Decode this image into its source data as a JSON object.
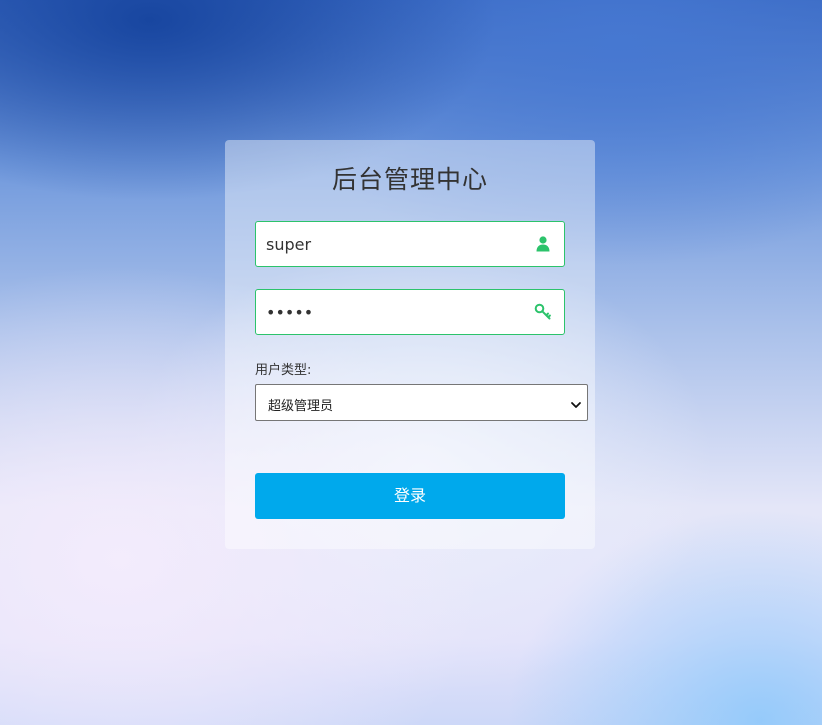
{
  "login": {
    "title": "后台管理中心",
    "username_value": "super",
    "password_value": "•••••",
    "user_type_label": "用户类型:",
    "user_type_selected": "超级管理员",
    "submit_label": "登录"
  },
  "icons": {
    "username": "user-icon",
    "password": "key-icon",
    "select": "chevron-down-icon"
  },
  "colors": {
    "field_border": "#2cc36b",
    "icon_green": "#2cc36b",
    "button": "#00a9ec"
  }
}
